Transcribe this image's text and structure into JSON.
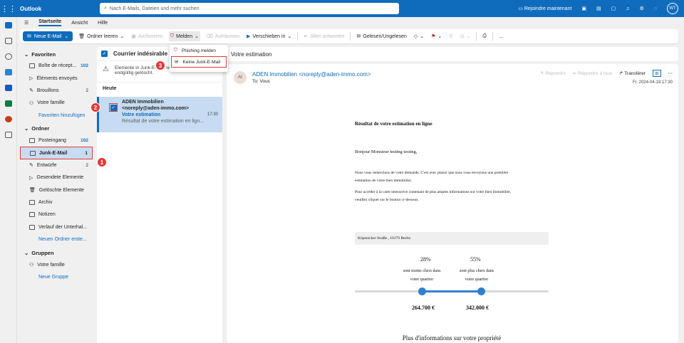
{
  "app": {
    "name": "Outlook",
    "search_placeholder": "Nach E-Mails, Dateien und mehr suchen",
    "rejoin": "Rejoindre maintenant",
    "user_initials": "WT"
  },
  "tabs": [
    "Startseite",
    "Ansicht",
    "Hilfe"
  ],
  "ribbon": {
    "new_mail": "Neue E-Mail",
    "empty_folder": "Ordner leeren",
    "archive": "Archivieren",
    "report": "Melden",
    "block": "Aufräumen",
    "move": "Verschieben in",
    "reply_all": "Allen antworten",
    "read_unread": "Gelesen/Ungelesen",
    "more": "…"
  },
  "report_menu": {
    "phishing": "Phishing melden",
    "not_junk": "Keine Junk-E-Mail"
  },
  "favorites": {
    "title": "Favoriten",
    "items": [
      {
        "label": "Boîte de récept...",
        "count": "102"
      },
      {
        "label": "Éléments envoyés",
        "count": ""
      },
      {
        "label": "Brouillons",
        "count": "2"
      },
      {
        "label": "Votre famille",
        "count": ""
      }
    ],
    "add": "Favoriten hinzufügen"
  },
  "folders": {
    "title": "Ordner",
    "items": [
      {
        "label": "Posteingang",
        "count": "102"
      },
      {
        "label": "Junk-E-Mail",
        "count": "1"
      },
      {
        "label": "Entwürfe",
        "count": "2"
      },
      {
        "label": "Gesendete Elemente",
        "count": ""
      },
      {
        "label": "Gelöschte Elemente",
        "count": ""
      },
      {
        "label": "Archiv",
        "count": ""
      },
      {
        "label": "Notizen",
        "count": ""
      },
      {
        "label": "Verlauf der Unterhal...",
        "count": ""
      }
    ],
    "new_folder": "Neuen Ordner erste..."
  },
  "groups": {
    "title": "Gruppen",
    "items": [
      {
        "label": "Votre famille"
      }
    ],
    "new_group": "Neue Gruppe"
  },
  "message_list": {
    "header": "Courrier indésirable",
    "notice_1": "Elemente in Junk-E-Mail werden",
    "notice_2": "endgültig gelöscht.",
    "group": "Heute",
    "message": {
      "from_1": "ADEN Immobilien",
      "from_2": "<noreply@aden-immo.com>",
      "subject": "Votre estimation",
      "time": "17:30",
      "preview": "Résultat de votre estimation en lign..."
    }
  },
  "reading": {
    "subject": "Votre estimation",
    "avatar": "AI",
    "sender": "ADEN Immobilien <noreply@aden-immo.com>",
    "to": "To:  Vous",
    "reply": "Répondre",
    "reply_all": "Répondre à tous",
    "forward": "Transférer",
    "date": "Fr, 2024-04-19 17:30"
  },
  "mail": {
    "title": "Résultat de votre estimation en ligne",
    "greeting": "Bonjour Monsieur testing testing,",
    "p1a": "Nous vous remercions de votre demande. C'est avec plaisir que nous vous envoyons une première",
    "p1b": "estimation de votre bien immobilier.",
    "p2a": "Pour accéder à la carte interactive contenant de plus amples informations sur votre bien immobilier,",
    "p2b": "veuillez cliquer sur le bouton ci-dessous.",
    "address": "Köpenicker Straße , 10179 Berlin",
    "pct_left": "28%",
    "pct_right": "55%",
    "lbl_left_1": "sont moins chers dans",
    "lbl_left_2": "votre quartier",
    "lbl_right_1": "sont plus chers dans",
    "lbl_right_2": "votre quartier",
    "price_left": "264.700 €",
    "price_right": "342.000 €",
    "more": "Plus d'informations sur votre propriété"
  },
  "badges": [
    "1",
    "2",
    "3"
  ]
}
